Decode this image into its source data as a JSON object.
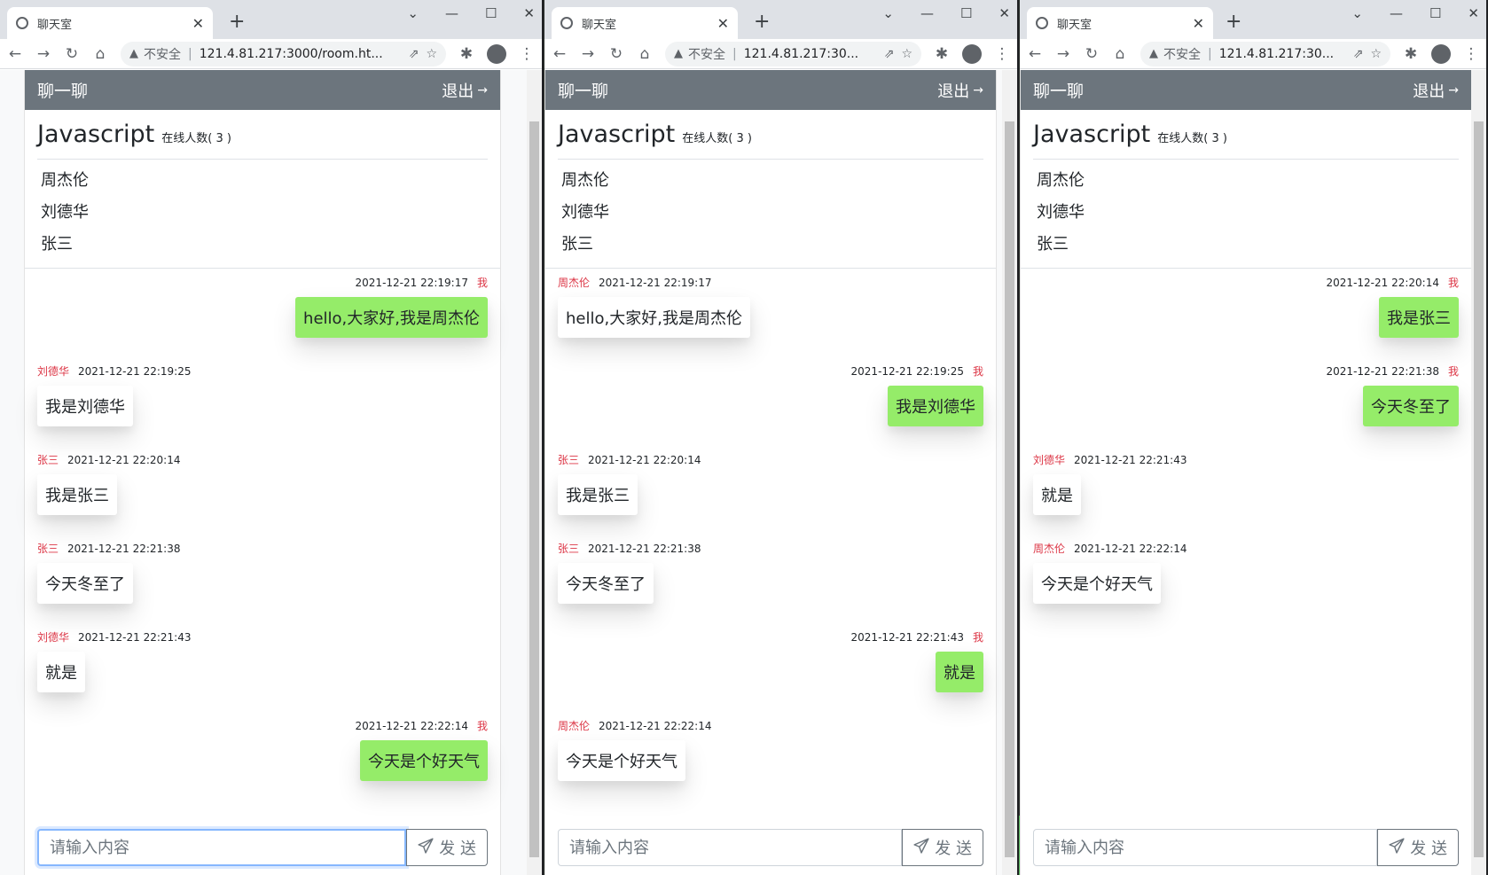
{
  "windows": [
    {
      "tab_title": "聊天室",
      "url": "121.4.81.217:3000/room.ht...",
      "insecure_label": "不安全",
      "app_title": "聊一聊",
      "logout_label": "退出",
      "room_name": "Javascript",
      "online_text": "在线人数( 3 )",
      "users": [
        "周杰伦",
        "刘德华",
        "张三"
      ],
      "messages": [
        {
          "author": "我",
          "time": "2021-12-21 22:19:17",
          "text": "hello,大家好,我是周杰伦",
          "mine": true
        },
        {
          "author": "刘德华",
          "time": "2021-12-21 22:19:25",
          "text": "我是刘德华",
          "mine": false
        },
        {
          "author": "张三",
          "time": "2021-12-21 22:20:14",
          "text": "我是张三",
          "mine": false
        },
        {
          "author": "张三",
          "time": "2021-12-21 22:21:38",
          "text": "今天冬至了",
          "mine": false
        },
        {
          "author": "刘德华",
          "time": "2021-12-21 22:21:43",
          "text": "就是",
          "mine": false
        },
        {
          "author": "我",
          "time": "2021-12-21 22:22:14",
          "text": "今天是个好天气",
          "mine": true
        }
      ],
      "input_placeholder": "请输入内容",
      "send_label": "发 送"
    },
    {
      "tab_title": "聊天室",
      "url": "121.4.81.217:30...",
      "insecure_label": "不安全",
      "app_title": "聊一聊",
      "logout_label": "退出",
      "room_name": "Javascript",
      "online_text": "在线人数( 3 )",
      "users": [
        "周杰伦",
        "刘德华",
        "张三"
      ],
      "messages": [
        {
          "author": "周杰伦",
          "time": "2021-12-21 22:19:17",
          "text": "hello,大家好,我是周杰伦",
          "mine": false
        },
        {
          "author": "我",
          "time": "2021-12-21 22:19:25",
          "text": "我是刘德华",
          "mine": true
        },
        {
          "author": "张三",
          "time": "2021-12-21 22:20:14",
          "text": "我是张三",
          "mine": false
        },
        {
          "author": "张三",
          "time": "2021-12-21 22:21:38",
          "text": "今天冬至了",
          "mine": false
        },
        {
          "author": "我",
          "time": "2021-12-21 22:21:43",
          "text": "就是",
          "mine": true
        },
        {
          "author": "周杰伦",
          "time": "2021-12-21 22:22:14",
          "text": "今天是个好天气",
          "mine": false
        }
      ],
      "input_placeholder": "请输入内容",
      "send_label": "发 送"
    },
    {
      "tab_title": "聊天室",
      "url": "121.4.81.217:30...",
      "insecure_label": "不安全",
      "app_title": "聊一聊",
      "logout_label": "退出",
      "room_name": "Javascript",
      "online_text": "在线人数( 3 )",
      "users": [
        "周杰伦",
        "刘德华",
        "张三"
      ],
      "messages": [
        {
          "author": "我",
          "time": "2021-12-21 22:20:14",
          "text": "我是张三",
          "mine": true
        },
        {
          "author": "我",
          "time": "2021-12-21 22:21:38",
          "text": "今天冬至了",
          "mine": true
        },
        {
          "author": "刘德华",
          "time": "2021-12-21 22:21:43",
          "text": "就是",
          "mine": false
        },
        {
          "author": "周杰伦",
          "time": "2021-12-21 22:22:14",
          "text": "今天是个好天气",
          "mine": false
        }
      ],
      "input_placeholder": "请输入内容",
      "send_label": "发 送"
    }
  ],
  "colors": {
    "header_bg": "#6c757d",
    "my_bubble": "#95ec69",
    "author_red": "#dc3545"
  }
}
